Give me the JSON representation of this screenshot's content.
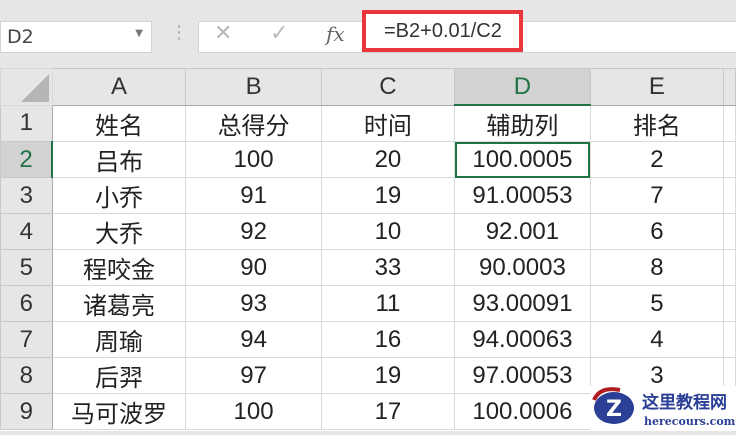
{
  "name_box": "D2",
  "formula": "=B2+0.01/C2",
  "columns": [
    "A",
    "B",
    "C",
    "D",
    "E"
  ],
  "rows": [
    [
      "1",
      "姓名",
      "总得分",
      "时间",
      "辅助列",
      "排名"
    ],
    [
      "2",
      "吕布",
      "100",
      "20",
      "100.0005",
      "2"
    ],
    [
      "3",
      "小乔",
      "91",
      "19",
      "91.00053",
      "7"
    ],
    [
      "4",
      "大乔",
      "92",
      "10",
      "92.001",
      "6"
    ],
    [
      "5",
      "程咬金",
      "90",
      "33",
      "90.0003",
      "8"
    ],
    [
      "6",
      "诸葛亮",
      "93",
      "11",
      "93.00091",
      "5"
    ],
    [
      "7",
      "周瑜",
      "94",
      "16",
      "94.00063",
      "4"
    ],
    [
      "8",
      "后羿",
      "97",
      "19",
      "97.00053",
      "3"
    ],
    [
      "9",
      "马可波罗",
      "100",
      "17",
      "100.0006",
      ""
    ]
  ],
  "watermark": {
    "title": "这里教程网",
    "url": "herecours.com"
  }
}
